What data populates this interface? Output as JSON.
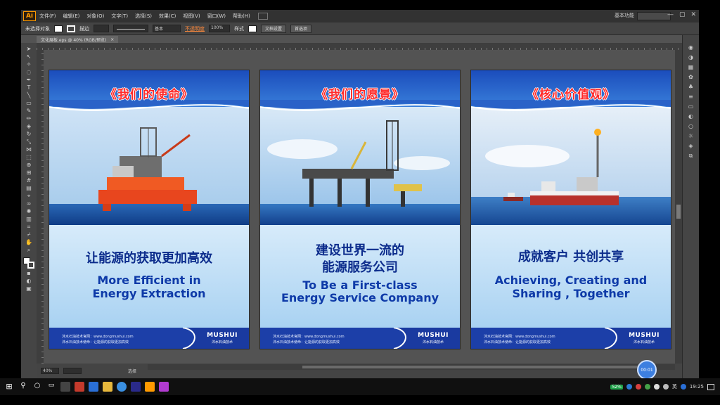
{
  "app": {
    "logo": "Ai",
    "menu": [
      "文件(F)",
      "编辑(E)",
      "对象(O)",
      "文字(T)",
      "选择(S)",
      "效果(C)",
      "视图(V)",
      "窗口(W)",
      "帮助(H)"
    ],
    "workspace": "基本功能",
    "window_controls": [
      "—",
      "▢",
      "✕"
    ]
  },
  "controlbar": {
    "no_selection": "未选择对象",
    "stroke_label": "描边",
    "stroke_preset": "基本",
    "style_label": "样式",
    "opacity_label": "不透明度",
    "opacity_value": "100%",
    "doc_setup": "文档设置",
    "preferences": "首选项"
  },
  "document": {
    "tab_title": "文化展板.eps @ 40% (RGB/预览)",
    "zoom": "40%",
    "status_text": "选择"
  },
  "posters": [
    {
      "title": "《我们的使命》",
      "cn": [
        "让能源的获取更加高效"
      ],
      "en": [
        "More Efficient in",
        "Energy Extraction"
      ],
      "footer_line1": "沐水石油技术官网：www.dongmushui.com",
      "footer_line2": "沐水石油技术使命：让能源的获取更加高效",
      "brand": "MUSHUI",
      "brand_cn": "沐水石油技术"
    },
    {
      "title": "《我们的愿景》",
      "cn": [
        "建设世界一流的",
        "能源服务公司"
      ],
      "en": [
        "To Be a First-class",
        "Energy Service Company"
      ],
      "footer_line1": "沐水石油技术官网：www.dongmushui.com",
      "footer_line2": "沐水石油技术使命：让能源的获取更加高效",
      "brand": "MUSHUI",
      "brand_cn": "沐水石油技术"
    },
    {
      "title": "《核心价值观》",
      "cn": [
        "成就客户 共创共享"
      ],
      "en": [
        "Achieving, Creating and",
        "Sharing , Together"
      ],
      "footer_line1": "沐水石油技术官网：www.dongmushui.com",
      "footer_line2": "沐水石油技术使命：让能源的获取更加高效",
      "brand": "MUSHUI",
      "brand_cn": "沐水石油技术"
    }
  ],
  "timer": "00:01",
  "taskbar": {
    "battery": "52%",
    "ime": "英",
    "clock": "19:25"
  },
  "colors": {
    "poster_title": "#ff2a2a",
    "poster_text": "#0c2c8c",
    "poster_header": "#1b4dbc",
    "ui_bg": "#535353"
  }
}
